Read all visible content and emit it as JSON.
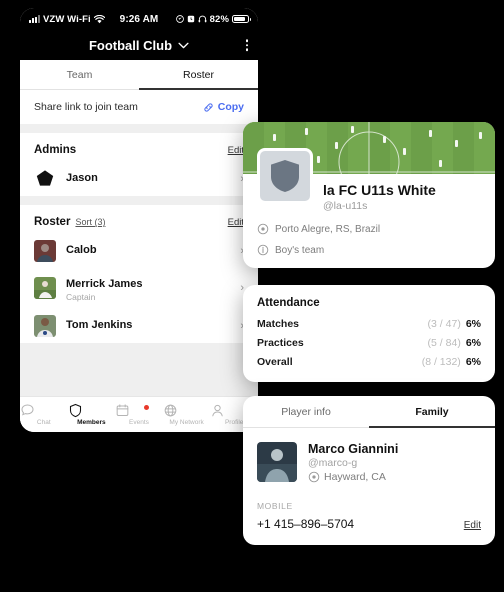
{
  "status_bar": {
    "carrier": "VZW Wi-Fi",
    "time": "9:26 AM",
    "battery_percent": "82%",
    "icons": [
      "signal-bars-icon",
      "wifi-icon",
      "location-arrow-icon",
      "alarm-icon",
      "headphones-icon",
      "battery-icon"
    ]
  },
  "nav": {
    "title": "Football Club",
    "chevron": "⌄",
    "more_label": "more-options"
  },
  "tabs": [
    {
      "label": "Team",
      "active": false
    },
    {
      "label": "Roster",
      "active": true
    }
  ],
  "share": {
    "text": "Share link to join team",
    "copy_label": "Copy",
    "copy_color": "#4a6cf0"
  },
  "admins": {
    "heading": "Admins",
    "edit_label": "Edit",
    "items": [
      {
        "name": "Jason",
        "subtitle": ""
      }
    ]
  },
  "roster": {
    "heading": "Roster",
    "sort_label": "Sort (3)",
    "edit_label": "Edit",
    "items": [
      {
        "name": "Calob",
        "subtitle": ""
      },
      {
        "name": "Merrick James",
        "subtitle": "Captain"
      },
      {
        "name": "Tom Jenkins",
        "subtitle": ""
      }
    ]
  },
  "bottom_nav": [
    {
      "label": "Chat",
      "icon": "chat-bubble-icon",
      "active": false,
      "badge": false
    },
    {
      "label": "Members",
      "icon": "shield-icon",
      "active": true,
      "badge": false
    },
    {
      "label": "Events",
      "icon": "calendar-icon",
      "active": false,
      "badge": true
    },
    {
      "label": "My Network",
      "icon": "globe-icon",
      "active": false,
      "badge": false
    },
    {
      "label": "Profile",
      "icon": "person-icon",
      "active": false,
      "badge": false
    }
  ],
  "team_card": {
    "name": "la FC U11s White",
    "handle": "@la-u11s",
    "location": "Porto Alegre, RS, Brazil",
    "location_icon": "location-pin-icon",
    "type": "Boy's team",
    "type_icon": "info-icon",
    "crest_icon": "shield-icon",
    "banner_alt": "soccer-field-photo"
  },
  "attendance_card": {
    "title": "Attendance",
    "rows": [
      {
        "label": "Matches",
        "fraction": "(3 / 47)",
        "percent": "6%"
      },
      {
        "label": "Practices",
        "fraction": "(5 / 84)",
        "percent": "6%"
      },
      {
        "label": "Overall",
        "fraction": "(8 / 132)",
        "percent": "6%"
      }
    ]
  },
  "player_card": {
    "tabs": [
      {
        "label": "Player info",
        "active": false
      },
      {
        "label": "Family",
        "active": true
      }
    ],
    "name": "Marco Giannini",
    "handle": "@marco-g",
    "location": "Hayward, CA",
    "location_icon": "location-pin-icon",
    "field_label": "MOBILE",
    "field_value": "+1 415–896–5704",
    "edit_label": "Edit"
  }
}
